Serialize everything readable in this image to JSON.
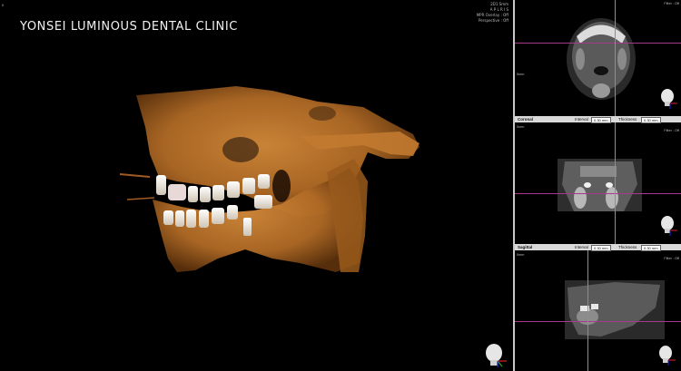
{
  "clinic": {
    "name": "YONSEI LUMINOUS DENTAL CLINIC"
  },
  "main_view": {
    "corner_label": "0",
    "status_lines": [
      "2D1 Smm",
      "A P L R I S",
      "MPR Overlay : Off",
      "Perspective : Off"
    ]
  },
  "panels": {
    "axial": {
      "side_top": "0mm",
      "side_right": "Filter : Off"
    },
    "coronal": {
      "name": "Coronal",
      "interval_label": "Interval",
      "interval_value": "0.30 mm",
      "thickness_label": "Thickness",
      "thickness_value": "0.30 mm",
      "side_left": "0mm",
      "side_right": "Filter : Off"
    },
    "sagittal": {
      "name": "Sagittal",
      "interval_label": "Interval",
      "interval_value": "0.30 mm",
      "thickness_label": "Thickness",
      "thickness_value": "0.30 mm",
      "side_left": "0mm",
      "side_right": "Filter : Off"
    }
  },
  "colors": {
    "bone": "#b06a25",
    "crosshair_horizontal": "#a53a8a",
    "crosshair_vertical": "#8fa324",
    "divider": "#c8c8c8"
  },
  "icons": {
    "orientation_head": "head-orientation-icon"
  }
}
